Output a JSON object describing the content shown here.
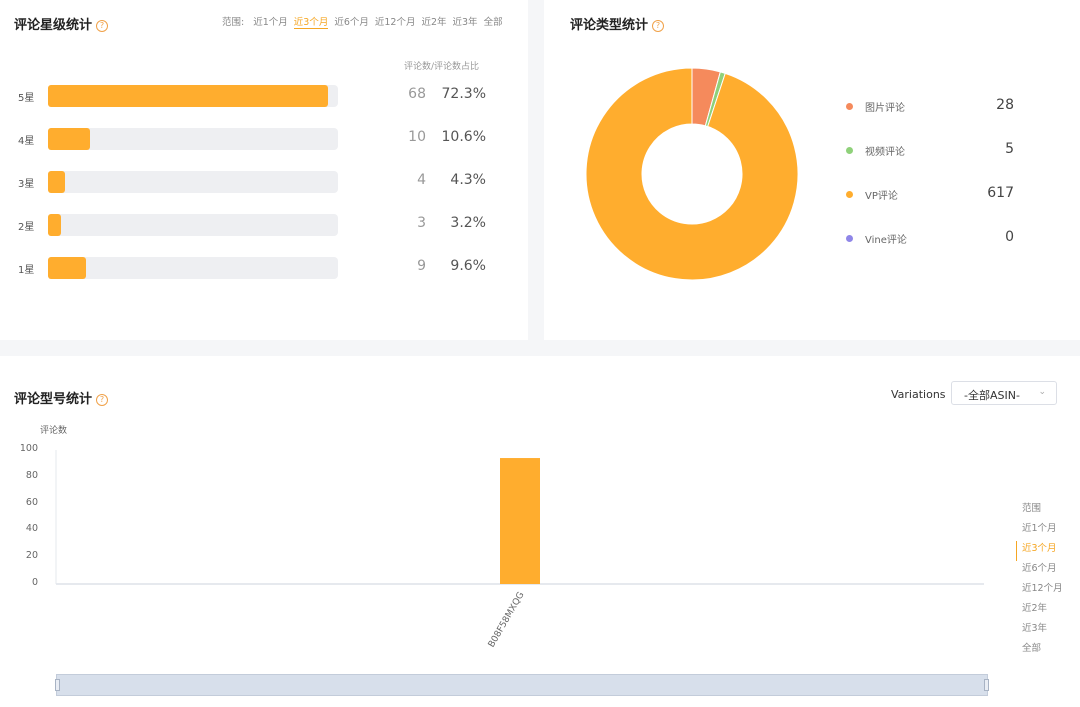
{
  "rating_panel": {
    "title": "评论星级统计",
    "help": "?",
    "range_label": "范围:",
    "ranges": [
      "近1个月",
      "近3个月",
      "近6个月",
      "近12个月",
      "近2年",
      "近3年",
      "全部"
    ],
    "active_range": 1,
    "column_header": "评论数/评论数占比",
    "rows": [
      {
        "label": "5星",
        "count": "68",
        "percent": "72.3%",
        "fill": 0.965
      },
      {
        "label": "4星",
        "count": "10",
        "percent": "10.6%",
        "fill": 0.145
      },
      {
        "label": "3星",
        "count": "4",
        "percent": "4.3%",
        "fill": 0.06
      },
      {
        "label": "2星",
        "count": "3",
        "percent": "3.2%",
        "fill": 0.045
      },
      {
        "label": "1星",
        "count": "9",
        "percent": "9.6%",
        "fill": 0.13
      }
    ]
  },
  "type_panel": {
    "title": "评论类型统计",
    "help": "?",
    "legend": [
      {
        "label": "图片评论",
        "value": "28",
        "color": "#f58a5c"
      },
      {
        "label": "视频评论",
        "value": "5",
        "color": "#8fd17a"
      },
      {
        "label": "VP评论",
        "value": "617",
        "color": "#ffad2e"
      },
      {
        "label": "Vine评论",
        "value": "0",
        "color": "#8f86e8"
      }
    ]
  },
  "model_panel": {
    "title": "评论型号统计",
    "help": "?",
    "variations_label": "Variations",
    "select_value": "-全部ASIN-",
    "range_label": "范围",
    "ranges": [
      "近1个月",
      "近3个月",
      "近6个月",
      "近12个月",
      "近2年",
      "近3年",
      "全部"
    ],
    "active_range": 1
  },
  "chart_data": [
    {
      "type": "pie",
      "title": "评论类型统计",
      "labels": [
        "图片评论",
        "视频评论",
        "VP评论",
        "Vine评论"
      ],
      "values": [
        28,
        5,
        617,
        0
      ],
      "colors": [
        "#f58a5c",
        "#8fd17a",
        "#ffad2e",
        "#8f86e8"
      ],
      "legend": "right"
    },
    {
      "type": "bar",
      "title": "评论型号统计",
      "ylabel": "评论数",
      "categories": [
        "B08F58MXQG"
      ],
      "values": [
        94
      ],
      "ylim": [
        0,
        100
      ],
      "yticks": [
        0,
        20,
        40,
        60,
        80,
        100
      ],
      "color": "#ffad2e",
      "grid": false
    }
  ]
}
